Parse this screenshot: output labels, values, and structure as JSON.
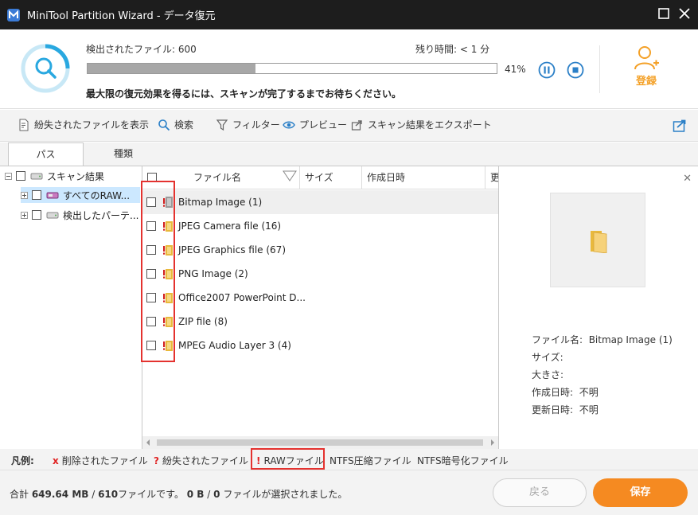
{
  "window": {
    "title": "MiniTool Partition Wizard - データ復元"
  },
  "scan": {
    "found_label": "検出されたファイル:  600",
    "remaining_label": "残り時間:  < 1 分",
    "progress_percent": 41,
    "progress_text": "41%",
    "hint": "最大限の復元効果を得るには、スキャンが完了するまでお待ちください。",
    "register_label": "登録"
  },
  "toolbar": {
    "lost_files": "紛失されたファイルを表示",
    "search": "検索",
    "filter": "フィルター",
    "preview": "プレビュー",
    "export": "スキャン結果をエクスポート"
  },
  "tabs": {
    "path": "パス",
    "type": "種類"
  },
  "tree": {
    "root": "スキャン結果",
    "items": [
      {
        "label": "すべてのRAW..."
      },
      {
        "label": "検出したパーテ..."
      }
    ]
  },
  "list": {
    "columns": [
      "ファイル名",
      "サイズ",
      "作成日時",
      "更"
    ],
    "rows": [
      {
        "name": "Bitmap Image (1)"
      },
      {
        "name": "JPEG Camera file (16)"
      },
      {
        "name": "JPEG Graphics file (67)"
      },
      {
        "name": "PNG Image (2)"
      },
      {
        "name": "Office2007 PowerPoint D..."
      },
      {
        "name": "ZIP file (8)"
      },
      {
        "name": "MPEG Audio Layer 3 (4)"
      }
    ]
  },
  "preview": {
    "filename_label": "ファイル名:",
    "filename_value": "Bitmap Image (1)",
    "size_label": "サイズ:",
    "dimensions_label": "大きさ:",
    "created_label": "作成日時:",
    "created_value": "不明",
    "modified_label": "更新日時:",
    "modified_value": "不明"
  },
  "legend": {
    "title": "凡例:",
    "deleted_mark": "x",
    "deleted": "削除されたファイル",
    "lost_mark": "?",
    "lost": "紛失されたファイル",
    "raw_mark": "!",
    "raw": "RAWファイル",
    "ntfs_compressed": "NTFS圧縮ファイル",
    "ntfs_encrypted": "NTFS暗号化ファイル"
  },
  "footer": {
    "total_prefix": "合計 ",
    "total_size": "649.64 MB",
    "sep": " / ",
    "total_files": "610",
    "files_suffix": "ファイルです。",
    "selected_size": "0 B",
    "selected_files": "0",
    "selected_suffix": " ファイルが選択されました。",
    "back": "戻る",
    "save": "保存"
  },
  "colors": {
    "accent_orange": "#f58a21",
    "highlight_red": "#e4322f",
    "titlebar": "#1d1d1d",
    "ring_blue": "#29a8e0"
  }
}
